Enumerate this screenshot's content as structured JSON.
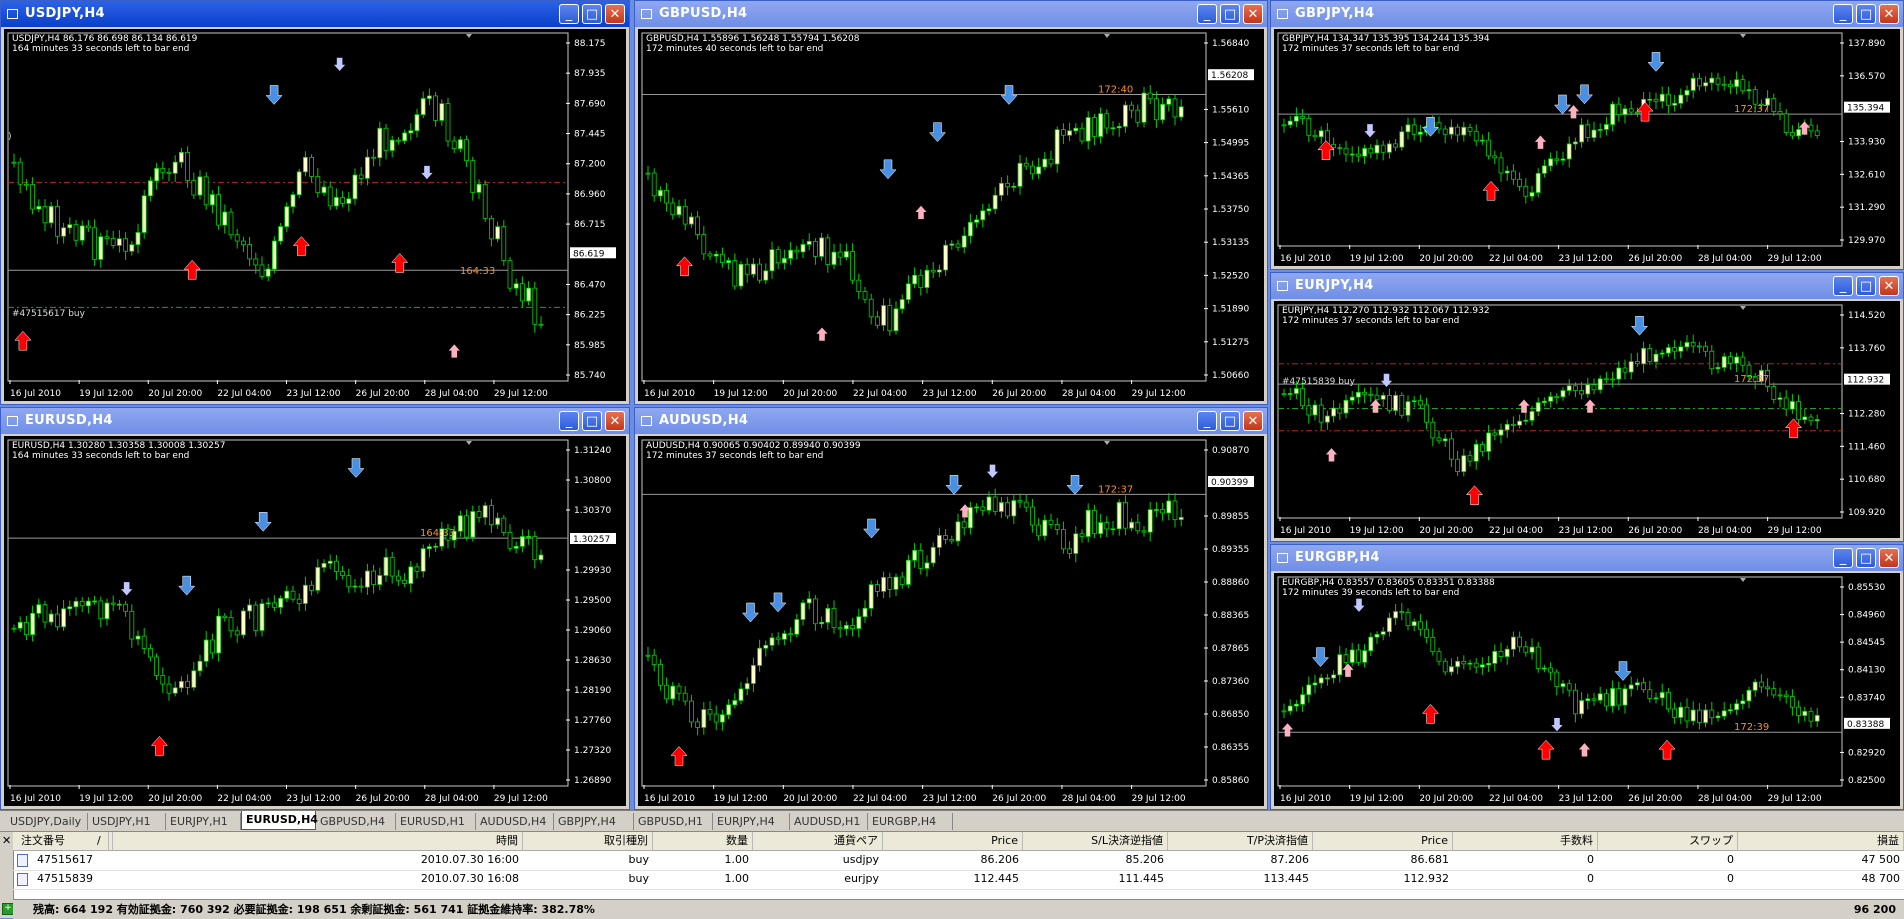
{
  "colors": {
    "bull": "#ffffc8",
    "bear": "#000000",
    "wick": "#00d000",
    "axis": "#ffffff",
    "sell_arrow": "#4a90e2",
    "buy_arrow": "#ff0000",
    "buy_small": "#ffb0c0",
    "sell_small": "#c0c8ff",
    "countdown": "#ff8c1a"
  },
  "charts": [
    {
      "title": "USDJPY,H4",
      "info1": "USDJPY,H4  86.176 86.698 86.134 86.619",
      "info2": "164 minutes 33 seconds left to bar end",
      "price_labels": [
        "88.175",
        "87.935",
        "87.690",
        "87.445",
        "87.200",
        "86.960",
        "86.715",
        "86.619",
        "86.470",
        "86.225",
        "85.985",
        "85.740"
      ],
      "time_labels": [
        "16 Jul 2010",
        "19 Jul 12:00",
        "20 Jul 20:00",
        "22 Jul 04:00",
        "23 Jul 12:00",
        "26 Jul 20:00",
        "28 Jul 04:00",
        "29 Jul 12:00"
      ],
      "current_price": "86.619",
      "countdown": "164:33",
      "order_label": "#47515617 buy",
      "symbol_mark": ")"
    },
    {
      "title": "GBPUSD,H4",
      "info1": "GBPUSD,H4  1.55896 1.56248 1.55794 1.56208",
      "info2": "172 minutes 40 seconds left to bar end",
      "price_labels": [
        "1.56840",
        "1.56208",
        "1.55610",
        "1.54995",
        "1.54365",
        "1.53750",
        "1.53135",
        "1.52520",
        "1.51890",
        "1.51275",
        "1.50660"
      ],
      "time_labels": [
        "16 Jul 2010",
        "19 Jul 12:00",
        "20 Jul 20:00",
        "22 Jul 04:00",
        "23 Jul 12:00",
        "26 Jul 20:00",
        "28 Jul 04:00",
        "29 Jul 12:00"
      ],
      "current_price": "1.56208",
      "countdown": "172:40"
    },
    {
      "title": "GBPJPY,H4",
      "info1": "GBPJPY,H4  134.347 135.395 134.244 135.394",
      "info2": "172 minutes 37 seconds left to bar end",
      "price_labels": [
        "137.890",
        "136.570",
        "135.394",
        "133.930",
        "132.610",
        "131.290",
        "129.970"
      ],
      "time_labels": [
        "16 Jul 2010",
        "19 Jul 12:00",
        "20 Jul 20:00",
        "22 Jul 04:00",
        "23 Jul 12:00",
        "26 Jul 20:00",
        "28 Jul 04:00",
        "29 Jul 12:00"
      ],
      "current_price": "135.394",
      "countdown": "172:37"
    },
    {
      "title": "EURJPY,H4",
      "info1": "EURJPY,H4  112.270 112.932 112.067 112.932",
      "info2": "172 minutes 37 seconds left to bar end",
      "price_labels": [
        "114.520",
        "113.760",
        "112.932",
        "112.280",
        "111.460",
        "110.680",
        "109.920"
      ],
      "time_labels": [
        "16 Jul 2010",
        "19 Jul 12:00",
        "20 Jul 20:00",
        "22 Jul 04:00",
        "23 Jul 12:00",
        "26 Jul 20:00",
        "28 Jul 04:00",
        "29 Jul 12:00"
      ],
      "current_price": "112.932",
      "countdown": "172:37",
      "order_label": "#47515839 buy"
    },
    {
      "title": "EURUSD,H4",
      "info1": "EURUSD,H4  1.30280 1.30358 1.30008 1.30257",
      "info2": "164 minutes 33 seconds left to bar end",
      "price_labels": [
        "1.31240",
        "1.30800",
        "1.30370",
        "1.30257",
        "1.29930",
        "1.29500",
        "1.29060",
        "1.28630",
        "1.28190",
        "1.27760",
        "1.27320",
        "1.26890"
      ],
      "time_labels": [
        "16 Jul 2010",
        "19 Jul 12:00",
        "20 Jul 20:00",
        "22 Jul 04:00",
        "23 Jul 12:00",
        "26 Jul 20:00",
        "28 Jul 04:00",
        "29 Jul 12:00"
      ],
      "current_price": "1.30257",
      "countdown": "164:33"
    },
    {
      "title": "AUDUSD,H4",
      "info1": "AUDUSD,H4  0.90065 0.90402 0.89940 0.90399",
      "info2": "172 minutes 37 seconds left to bar end",
      "price_labels": [
        "0.90870",
        "0.90399",
        "0.89855",
        "0.89355",
        "0.88860",
        "0.88365",
        "0.87865",
        "0.87360",
        "0.86850",
        "0.86355",
        "0.85860"
      ],
      "time_labels": [
        "16 Jul 2010",
        "19 Jul 12:00",
        "20 Jul 20:00",
        "22 Jul 04:00",
        "23 Jul 12:00",
        "26 Jul 20:00",
        "28 Jul 04:00",
        "29 Jul 12:00"
      ],
      "current_price": "0.90399",
      "countdown": "172:37"
    },
    {
      "title": "EURGBP,H4",
      "info1": "EURGBP,H4  0.83557 0.83605 0.83351 0.83388",
      "info2": "172 minutes 39 seconds left to bar end",
      "price_labels": [
        "0.85530",
        "0.84960",
        "0.84545",
        "0.84130",
        "0.83740",
        "0.83388",
        "0.82920",
        "0.82500"
      ],
      "time_labels": [
        "16 Jul 2010",
        "19 Jul 12:00",
        "20 Jul 20:00",
        "22 Jul 04:00",
        "23 Jul 12:00",
        "26 Jul 20:00",
        "28 Jul 04:00",
        "29 Jul 12:00"
      ],
      "current_price": "0.83388",
      "countdown": "172:39"
    }
  ],
  "tabs": [
    "USDJPY,Daily",
    "USDJPY,H1",
    "EURJPY,H1",
    "EURUSD,H4",
    "GBPUSD,H4",
    "EURUSD,H1",
    "AUDUSD,H4",
    "GBPJPY,H4",
    "GBPUSD,H1",
    "EURJPY,H4",
    "AUDUSD,H1",
    "EURGBP,H4"
  ],
  "active_tab": "EURUSD,H4",
  "terminal": {
    "headers": [
      "注文番号",
      "/",
      "時間",
      "取引種別",
      "数量",
      "通貨ペア",
      "Price",
      "S/L決済逆指値",
      "T/P決済指値",
      "Price",
      "手数料",
      "スワップ",
      "損益"
    ],
    "rows": [
      [
        "47515617",
        "",
        "2010.07.30 16:00",
        "buy",
        "1.00",
        "usdjpy",
        "86.206",
        "85.206",
        "87.206",
        "86.681",
        "0",
        "0",
        "47 500"
      ],
      [
        "47515839",
        "",
        "2010.07.30 16:08",
        "buy",
        "1.00",
        "eurjpy",
        "112.445",
        "111.445",
        "113.445",
        "112.932",
        "0",
        "0",
        "48 700"
      ]
    ],
    "footer": "残高: 664 192  有効証拠金: 760 392  必要証拠金: 198 651  余剰証拠金: 561 741  証拠金維持率: 382.78%",
    "footer_pl": "96 200"
  }
}
